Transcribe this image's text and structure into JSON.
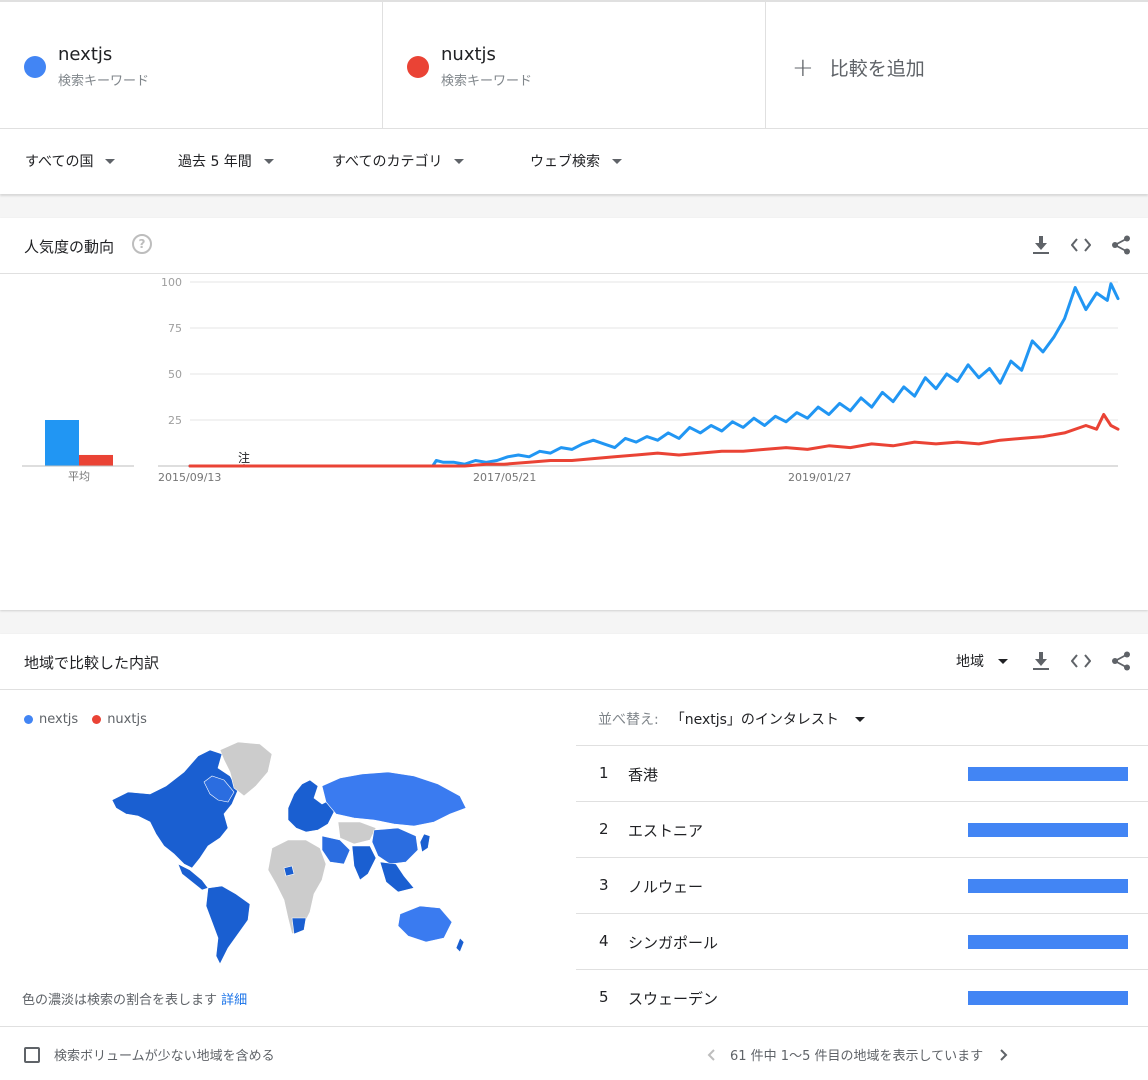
{
  "terms": [
    {
      "name": "nextjs",
      "sub": "検索キーワード",
      "color": "#4285f4"
    },
    {
      "name": "nuxtjs",
      "sub": "検索キーワード",
      "color": "#ea4335"
    }
  ],
  "add_compare": "比較を追加",
  "filters": {
    "country": "すべての国",
    "period": "過去 5 年間",
    "category": "すべてのカテゴリ",
    "search_type": "ウェブ検索"
  },
  "trend": {
    "title": "人気度の動向",
    "help_icon": "help-icon",
    "avg_label": "平均",
    "note_label": "注"
  },
  "chart_data": {
    "type": "line",
    "x_range": [
      "2015-09-13",
      "2020-09-06"
    ],
    "x_tick_labels": [
      "2015/09/13",
      "2017/05/21",
      "2019/01/27"
    ],
    "y_ticks": [
      25,
      50,
      75,
      100
    ],
    "ylim": [
      0,
      100
    ],
    "grid": true,
    "averages": [
      {
        "name": "nextjs",
        "value": 25
      },
      {
        "name": "nuxtjs",
        "value": 6
      }
    ],
    "series": [
      {
        "name": "nextjs",
        "color": "#2196f3",
        "points": [
          [
            "2015-09-13",
            0
          ],
          [
            "2015-11-15",
            0
          ],
          [
            "2016-02-07",
            0
          ],
          [
            "2016-06-05",
            0
          ],
          [
            "2016-10-02",
            0
          ],
          [
            "2017-01-01",
            0
          ],
          [
            "2017-01-08",
            3
          ],
          [
            "2017-01-22",
            2
          ],
          [
            "2017-02-12",
            2
          ],
          [
            "2017-03-05",
            1
          ],
          [
            "2017-03-26",
            3
          ],
          [
            "2017-04-16",
            2
          ],
          [
            "2017-05-07",
            3
          ],
          [
            "2017-05-28",
            5
          ],
          [
            "2017-06-18",
            6
          ],
          [
            "2017-07-09",
            5
          ],
          [
            "2017-07-30",
            8
          ],
          [
            "2017-08-20",
            7
          ],
          [
            "2017-09-10",
            10
          ],
          [
            "2017-10-01",
            9
          ],
          [
            "2017-10-22",
            12
          ],
          [
            "2017-11-12",
            14
          ],
          [
            "2017-12-03",
            12
          ],
          [
            "2017-12-24",
            10
          ],
          [
            "2018-01-14",
            15
          ],
          [
            "2018-02-04",
            13
          ],
          [
            "2018-02-25",
            16
          ],
          [
            "2018-03-18",
            14
          ],
          [
            "2018-04-08",
            18
          ],
          [
            "2018-04-29",
            15
          ],
          [
            "2018-05-20",
            21
          ],
          [
            "2018-06-10",
            18
          ],
          [
            "2018-07-01",
            22
          ],
          [
            "2018-07-22",
            19
          ],
          [
            "2018-08-12",
            24
          ],
          [
            "2018-09-02",
            21
          ],
          [
            "2018-09-23",
            26
          ],
          [
            "2018-10-14",
            22
          ],
          [
            "2018-11-04",
            27
          ],
          [
            "2018-11-25",
            24
          ],
          [
            "2018-12-16",
            29
          ],
          [
            "2019-01-06",
            26
          ],
          [
            "2019-01-27",
            32
          ],
          [
            "2019-02-17",
            28
          ],
          [
            "2019-03-10",
            34
          ],
          [
            "2019-03-31",
            30
          ],
          [
            "2019-04-21",
            37
          ],
          [
            "2019-05-12",
            32
          ],
          [
            "2019-06-02",
            40
          ],
          [
            "2019-06-23",
            35
          ],
          [
            "2019-07-14",
            43
          ],
          [
            "2019-08-04",
            38
          ],
          [
            "2019-08-25",
            48
          ],
          [
            "2019-09-15",
            42
          ],
          [
            "2019-10-06",
            50
          ],
          [
            "2019-10-27",
            46
          ],
          [
            "2019-11-17",
            55
          ],
          [
            "2019-12-08",
            48
          ],
          [
            "2019-12-29",
            53
          ],
          [
            "2020-01-19",
            45
          ],
          [
            "2020-02-09",
            57
          ],
          [
            "2020-03-01",
            52
          ],
          [
            "2020-03-22",
            68
          ],
          [
            "2020-04-12",
            62
          ],
          [
            "2020-05-03",
            70
          ],
          [
            "2020-05-24",
            80
          ],
          [
            "2020-06-14",
            97
          ],
          [
            "2020-07-05",
            85
          ],
          [
            "2020-07-26",
            94
          ],
          [
            "2020-08-16",
            90
          ],
          [
            "2020-08-23",
            99
          ],
          [
            "2020-09-06",
            91
          ]
        ]
      },
      {
        "name": "nuxtjs",
        "color": "#ea4335",
        "points": [
          [
            "2015-09-13",
            0
          ],
          [
            "2016-06-05",
            0
          ],
          [
            "2017-01-01",
            0
          ],
          [
            "2017-03-05",
            0
          ],
          [
            "2017-04-16",
            1
          ],
          [
            "2017-05-21",
            1
          ],
          [
            "2017-07-09",
            2
          ],
          [
            "2017-08-20",
            3
          ],
          [
            "2017-10-01",
            3
          ],
          [
            "2017-11-12",
            4
          ],
          [
            "2017-12-24",
            5
          ],
          [
            "2018-02-04",
            6
          ],
          [
            "2018-03-18",
            7
          ],
          [
            "2018-04-29",
            6
          ],
          [
            "2018-06-10",
            7
          ],
          [
            "2018-07-22",
            8
          ],
          [
            "2018-09-02",
            8
          ],
          [
            "2018-10-14",
            9
          ],
          [
            "2018-11-25",
            10
          ],
          [
            "2019-01-06",
            9
          ],
          [
            "2019-02-17",
            11
          ],
          [
            "2019-03-31",
            10
          ],
          [
            "2019-05-12",
            12
          ],
          [
            "2019-06-23",
            11
          ],
          [
            "2019-08-04",
            13
          ],
          [
            "2019-09-15",
            12
          ],
          [
            "2019-10-27",
            13
          ],
          [
            "2019-12-08",
            12
          ],
          [
            "2020-01-19",
            14
          ],
          [
            "2020-03-01",
            15
          ],
          [
            "2020-04-12",
            16
          ],
          [
            "2020-05-24",
            18
          ],
          [
            "2020-07-05",
            22
          ],
          [
            "2020-07-26",
            20
          ],
          [
            "2020-08-09",
            28
          ],
          [
            "2020-08-23",
            22
          ],
          [
            "2020-09-06",
            20
          ]
        ]
      }
    ]
  },
  "region": {
    "title": "地域で比較した内訳",
    "select_label": "地域",
    "legend": [
      {
        "name": "nextjs",
        "color": "#4285f4"
      },
      {
        "name": "nuxtjs",
        "color": "#ea4335"
      }
    ],
    "map_note": "色の濃淡は検索の割合を表します",
    "map_note_link": "詳細",
    "sort_label": "並べ替え:",
    "sort_value": "「nextjs」のインタレスト",
    "items": [
      {
        "rank": "1",
        "name": "香港",
        "share": 100
      },
      {
        "rank": "2",
        "name": "エストニア",
        "share": 100
      },
      {
        "rank": "3",
        "name": "ノルウェー",
        "share": 100
      },
      {
        "rank": "4",
        "name": "シンガポール",
        "share": 100
      },
      {
        "rank": "5",
        "name": "スウェーデン",
        "share": 100
      }
    ],
    "low_volume_label": "検索ボリュームが少ない地域を含める",
    "pager_text": "61 件中 1～5 件目の地域を表示しています"
  }
}
